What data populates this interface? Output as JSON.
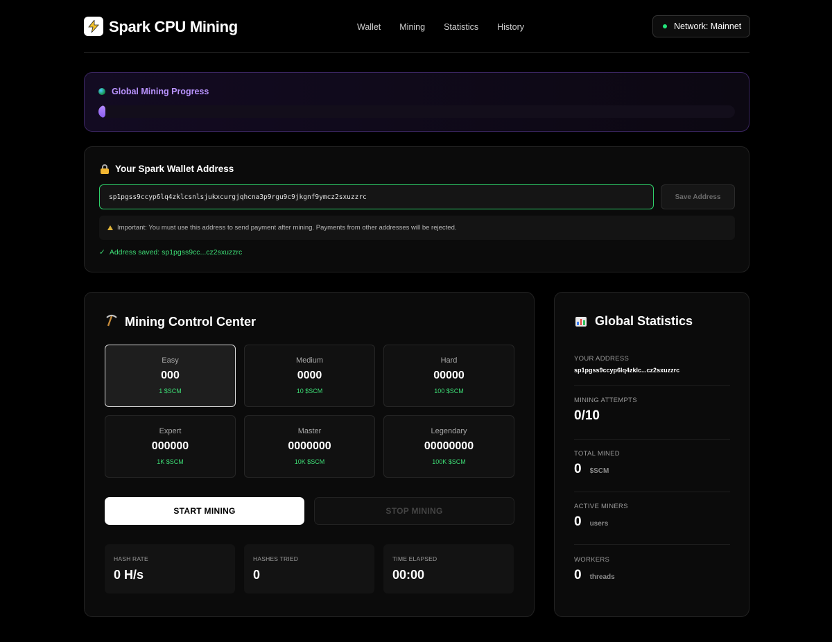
{
  "header": {
    "logo_icon": "lightning-bolt-icon",
    "brand": "Spark CPU Mining",
    "nav": [
      "Wallet",
      "Mining",
      "Statistics",
      "History"
    ],
    "network": "Network: Mainnet",
    "network_color": "#22e57a"
  },
  "progress": {
    "title": "Global Mining Progress",
    "fraction": 0.01,
    "accent": "#b993ff"
  },
  "wallet": {
    "title": "Your Spark Wallet Address",
    "address_value": "sp1pgss9ccyp6lq4zklcsnlsjukxcurgjqhcna3p9rgu9c9jkgnf9ymcz2sxuzzrc",
    "save_label": "Save Address",
    "warning": "Important: You must use this address to send payment after mining. Payments from other addresses will be rejected.",
    "saved_check": "✓",
    "saved_message": "Address saved: sp1pgss9cc...cz2sxuzzrc"
  },
  "mining": {
    "title": "Mining Control Center",
    "difficulties": [
      {
        "name": "Easy",
        "zeros": "000",
        "reward": "1 $SCM",
        "active": true
      },
      {
        "name": "Medium",
        "zeros": "0000",
        "reward": "10 $SCM",
        "active": false
      },
      {
        "name": "Hard",
        "zeros": "00000",
        "reward": "100 $SCM",
        "active": false
      },
      {
        "name": "Expert",
        "zeros": "000000",
        "reward": "1K $SCM",
        "active": false
      },
      {
        "name": "Master",
        "zeros": "0000000",
        "reward": "10K $SCM",
        "active": false
      },
      {
        "name": "Legendary",
        "zeros": "00000000",
        "reward": "100K $SCM",
        "active": false
      }
    ],
    "start_label": "START MINING",
    "stop_label": "STOP MINING",
    "stats": [
      {
        "label": "HASH RATE",
        "value": "0 H/s"
      },
      {
        "label": "HASHES TRIED",
        "value": "0"
      },
      {
        "label": "TIME ELAPSED",
        "value": "00:00"
      }
    ]
  },
  "global": {
    "title": "Global Statistics",
    "address_label": "YOUR ADDRESS",
    "address_value": "sp1pgss9ccyp6lq4zklc...cz2sxuzzrc",
    "attempts_label": "MINING ATTEMPTS",
    "attempts_value": "0/10",
    "mined_label": "TOTAL MINED",
    "mined_value": "0",
    "mined_unit": "$SCM",
    "miners_label": "ACTIVE MINERS",
    "miners_value": "0",
    "miners_unit": "users",
    "workers_label": "WORKERS",
    "workers_value": "0",
    "workers_unit": "threads"
  }
}
